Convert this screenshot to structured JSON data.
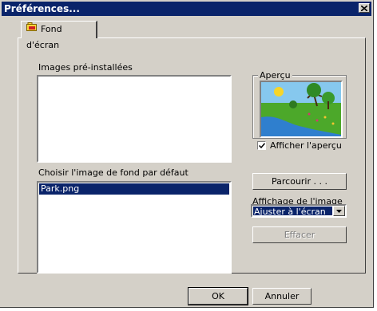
{
  "window": {
    "title": "Préférences..."
  },
  "tabs": [
    {
      "label": "Fond d'écran",
      "icon": "folder-picture-icon"
    }
  ],
  "preinstalled": {
    "label": "Images pré-installées",
    "items": []
  },
  "preview": {
    "group_label": "Aperçu",
    "show_label": "Afficher l'aperçu",
    "show_checked": true,
    "image": "landscape-preview-image"
  },
  "default_image": {
    "label": "Choisir l'image de fond par défaut",
    "items": [
      {
        "name": "Park.png",
        "selected": true
      }
    ]
  },
  "buttons": {
    "browse": "Parcourir . . .",
    "clear": "Effacer",
    "ok": "OK",
    "cancel": "Annuler"
  },
  "display": {
    "label": "Affichage de l'image",
    "selected": "Ajuster à l'écran"
  },
  "colors": {
    "titlebar": "#0a246a",
    "window_bg": "#d4d0c8",
    "selection": "#0a246a"
  }
}
